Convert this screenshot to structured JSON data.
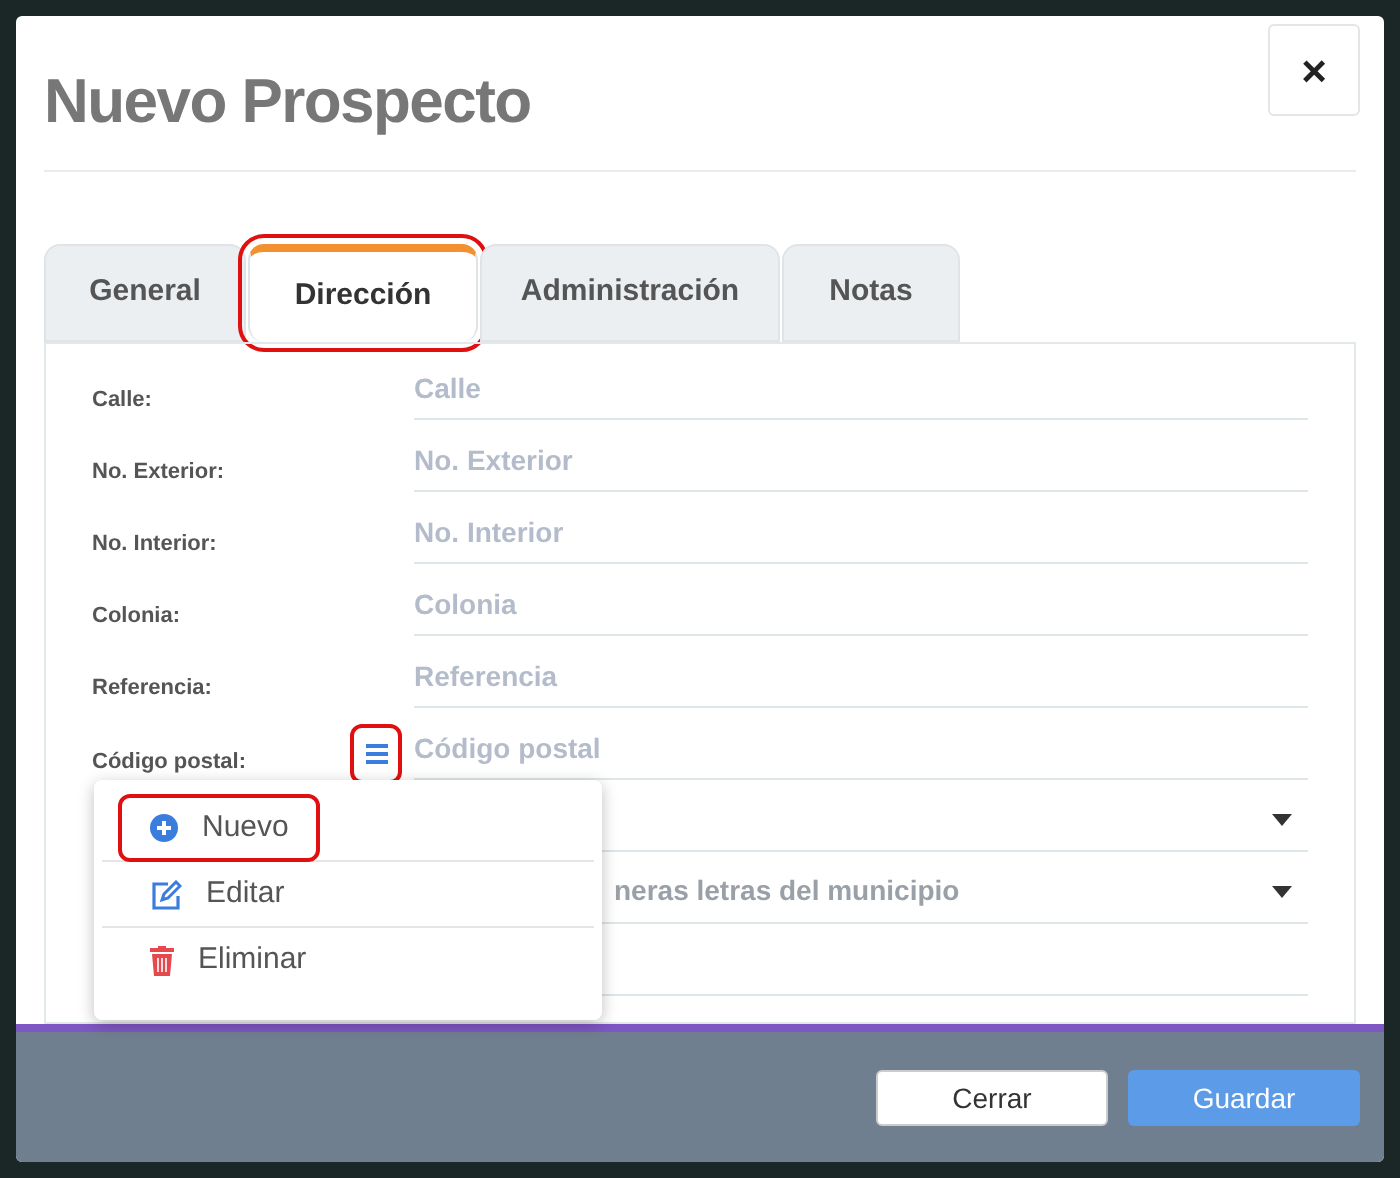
{
  "modal": {
    "title": "Nuevo Prospecto",
    "close_label": "×"
  },
  "tabs": [
    {
      "label": "General",
      "selected": false,
      "highlighted": false
    },
    {
      "label": "Dirección",
      "selected": true,
      "highlighted": true
    },
    {
      "label": "Administración",
      "selected": false,
      "highlighted": false
    },
    {
      "label": "Notas",
      "selected": false,
      "highlighted": false
    }
  ],
  "fields": [
    {
      "kind": "text",
      "label": "Calle:",
      "placeholder": "Calle"
    },
    {
      "kind": "text",
      "label": "No. Exterior:",
      "placeholder": "No. Exterior"
    },
    {
      "kind": "text",
      "label": "No. Interior:",
      "placeholder": "No. Interior"
    },
    {
      "kind": "text",
      "label": "Colonia:",
      "placeholder": "Colonia"
    },
    {
      "kind": "text",
      "label": "Referencia:",
      "placeholder": "Referencia"
    },
    {
      "kind": "text",
      "label": "Código postal:",
      "placeholder": "Código postal",
      "menu_button": {
        "highlighted": true
      }
    },
    {
      "kind": "select"
    },
    {
      "kind": "select",
      "value": "neras letras del municipio"
    },
    {
      "kind": "text"
    }
  ],
  "menu": {
    "items": [
      {
        "kind": "add",
        "label": "Nuevo",
        "highlighted": true
      },
      {
        "kind": "edit",
        "label": "Editar",
        "highlighted": false
      },
      {
        "kind": "delete",
        "label": "Eliminar",
        "highlighted": false
      }
    ]
  },
  "footer": {
    "buttons": [
      {
        "kind": "secondary",
        "label": "Cerrar"
      },
      {
        "kind": "primary",
        "label": "Guardar"
      }
    ]
  }
}
